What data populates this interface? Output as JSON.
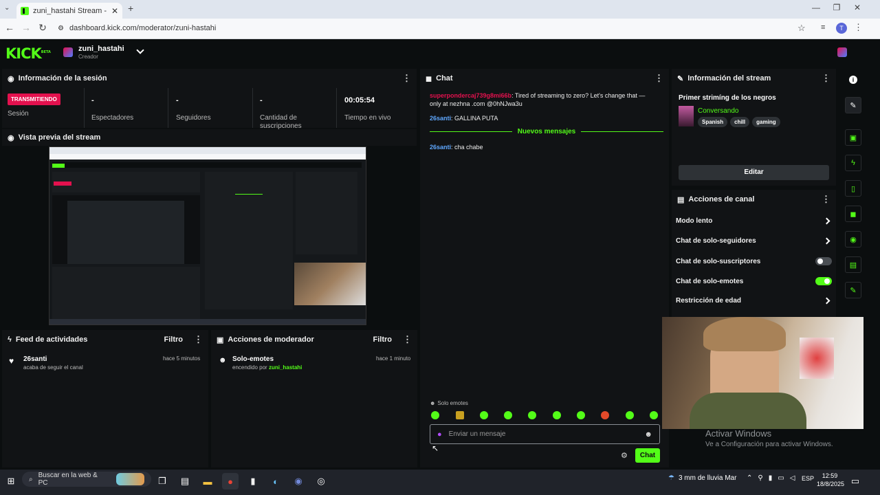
{
  "browser": {
    "tab_title": "zuni_hastahi Stream - Kick Dash",
    "url": "dashboard.kick.com/moderator/zuni-hastahi",
    "avatar_letter": "T"
  },
  "header": {
    "logo": "KICK",
    "logo_badge": "BETA",
    "channel_name": "zuni_hastahi",
    "role": "Creador"
  },
  "session": {
    "title": "Información de la sesión",
    "status": "TRANSMITIENDO",
    "status_label": "Sesión",
    "viewers_value": "-",
    "viewers_label": "Espectadores",
    "followers_value": "-",
    "followers_label": "Seguidores",
    "subs_value": "-",
    "subs_label": "Cantidad de suscripciones",
    "uptime_value": "00:05:54",
    "uptime_label": "Tiempo en vivo"
  },
  "preview": {
    "title": "Vista previa del stream"
  },
  "activity": {
    "title": "Feed de actividades",
    "filter": "Filtro",
    "user": "26santi",
    "text": "acaba de seguir el canal",
    "time": "hace 5 minutos"
  },
  "mod": {
    "title": "Acciones de moderador",
    "filter": "Filtro",
    "action": "Solo-emotes",
    "text": "encendido por",
    "by": "zuni_hastahi",
    "time": "hace 1 minuto"
  },
  "chat": {
    "title": "Chat",
    "msg1_user": "superpondercaj739g8mi66b",
    "msg1_text": ": Tired of streaming to zero? Let's change that — only at nezhna .com @0hNJwa3u",
    "msg2_user": "26santi",
    "msg2_text": ": GALLINA PUTA",
    "new_messages": "Nuevos mensajes",
    "msg3_user": "26santi",
    "msg3_text": ": cha chabe",
    "emotes_only": "Solo emotes",
    "input_placeholder": "Enviar un mensaje",
    "send": "Chat"
  },
  "stream_info": {
    "title": "Información del stream",
    "stream_title": "Primer strimíng de los negros",
    "category": "Conversando",
    "tags": [
      "Spanish",
      "chill",
      "gaming"
    ],
    "edit": "Editar"
  },
  "channel_actions": {
    "title": "Acciones de canal",
    "items": [
      "Modo lento",
      "Chat de solo-seguidores",
      "Chat de solo-suscriptores",
      "Chat de solo-emotes",
      "Restricción de edad"
    ],
    "subs_only_on": false,
    "emotes_only_on": true
  },
  "watermark": {
    "line1": "Activar Windows",
    "line2": "Ve a Configuración para activar Windows."
  },
  "taskbar": {
    "search": "Buscar en la web & PC",
    "weather": "3 mm de lluvia Mar",
    "lang": "ESP",
    "time": "12:59",
    "date": "18/8/2025"
  },
  "colors": {
    "accent": "#53fc18",
    "live": "#e3114e"
  }
}
